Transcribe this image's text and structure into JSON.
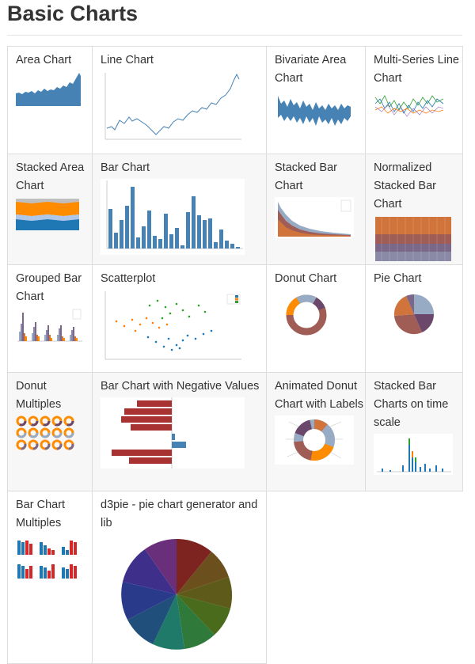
{
  "page": {
    "title": "Basic Charts"
  },
  "rows": [
    [
      "Area Chart",
      "Line Chart",
      "Bivariate Area Chart",
      "Multi-Series Line Chart"
    ],
    [
      "Stacked Area Chart",
      "Bar Chart",
      "Stacked Bar Chart",
      "Normalized Stacked Bar Chart"
    ],
    [
      "Grouped Bar Chart",
      "Scatterplot",
      "Donut Chart",
      "Pie Chart"
    ],
    [
      "Donut Multiples",
      "Bar Chart with Negative Values",
      "Animated Donut Chart with Labels",
      "Stacked Bar Charts on time scale"
    ],
    [
      "Bar Chart Multiples",
      "d3pie - pie chart generator and lib"
    ]
  ],
  "colors": {
    "steel": "#4682b4",
    "orange": "#ff8c00",
    "brown": "#a05d56",
    "purple": "#6b486b",
    "red": "#a83232",
    "green": "#2ca02c"
  }
}
